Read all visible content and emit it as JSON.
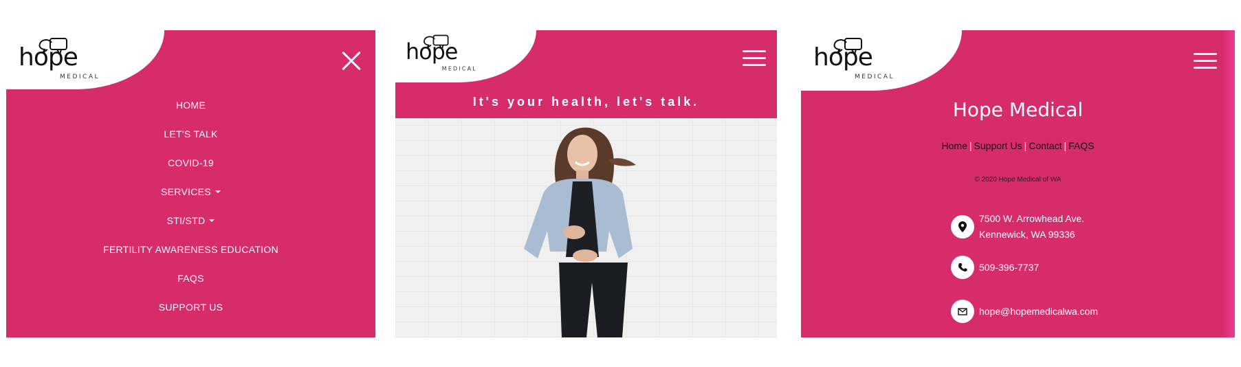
{
  "brand": {
    "logo_word": "hope",
    "logo_sub": "MEDICAL",
    "colors": {
      "primary": "#d62c6a",
      "white": "#ffffff"
    }
  },
  "menu_panel": {
    "close_icon": "close-icon",
    "items": [
      {
        "label": "HOME"
      },
      {
        "label": "LET'S TALK"
      },
      {
        "label": "COVID-19"
      },
      {
        "label": "SERVICES",
        "dropdown": true
      },
      {
        "label": "STI/STD",
        "dropdown": true
      },
      {
        "label": "FERTILITY AWARENESS EDUCATION"
      },
      {
        "label": "FAQS"
      },
      {
        "label": "SUPPORT US"
      }
    ]
  },
  "hero_panel": {
    "menu_icon": "hamburger-icon",
    "tagline": "It's your health, let's talk."
  },
  "footer_panel": {
    "menu_icon": "hamburger-icon",
    "title": "Hope Medical",
    "links": [
      "Home",
      "Support Us",
      "Contact",
      "FAQS"
    ],
    "copyright": "© 2020 Hope Medical of WA",
    "address_line1": "7500 W. Arrowhead Ave.",
    "address_line2": "Kennewick, WA 99336",
    "phone": "509-396-7737",
    "email": "hope@hopemedicalwa.com"
  }
}
